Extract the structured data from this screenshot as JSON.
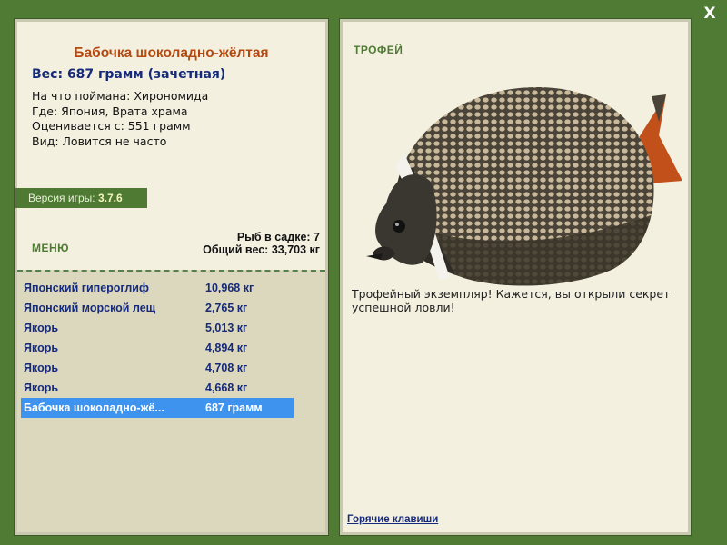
{
  "close_button": {
    "label": "X"
  },
  "fish": {
    "name": "Бабочка шоколадно-жёлтая",
    "weight_line": "Вес: 687 грамм (зачетная)",
    "info": [
      "На что поймана: Хирономида",
      "Где: Япония, Врата храма",
      "Оценивается с: 551 грамм",
      "Вид: Ловится не часто"
    ]
  },
  "version": {
    "label": "Версия игры:",
    "value": "3.7.6"
  },
  "menu": {
    "label": "МЕНЮ"
  },
  "stats": {
    "count": "Рыб в садке: 7",
    "total": "Общий вес: 33,703 кг"
  },
  "catch_list": [
    {
      "name": "Японский гипероглиф",
      "weight": "10,968 кг"
    },
    {
      "name": "Японский морской лещ",
      "weight": "2,765 кг"
    },
    {
      "name": "Якорь",
      "weight": "5,013 кг"
    },
    {
      "name": "Якорь",
      "weight": "4,894 кг"
    },
    {
      "name": "Якорь",
      "weight": "4,708 кг"
    },
    {
      "name": "Якорь",
      "weight": "4,668 кг"
    },
    {
      "name": "Бабочка шоколадно-жё...",
      "weight": "687 грамм"
    }
  ],
  "trophy": {
    "label": "ТРОФЕЙ",
    "text": "Трофейный экземпляр! Кажется, вы открыли секрет успешной ловли!"
  },
  "hotkeys": {
    "label": "Горячие клавиши"
  },
  "colors": {
    "background": "#4f7b34",
    "panel": "#f3f0e0",
    "list_area": "#dcd8be",
    "title": "#b44a10",
    "link_blue": "#162a7a",
    "selection": "#3e93ee"
  }
}
